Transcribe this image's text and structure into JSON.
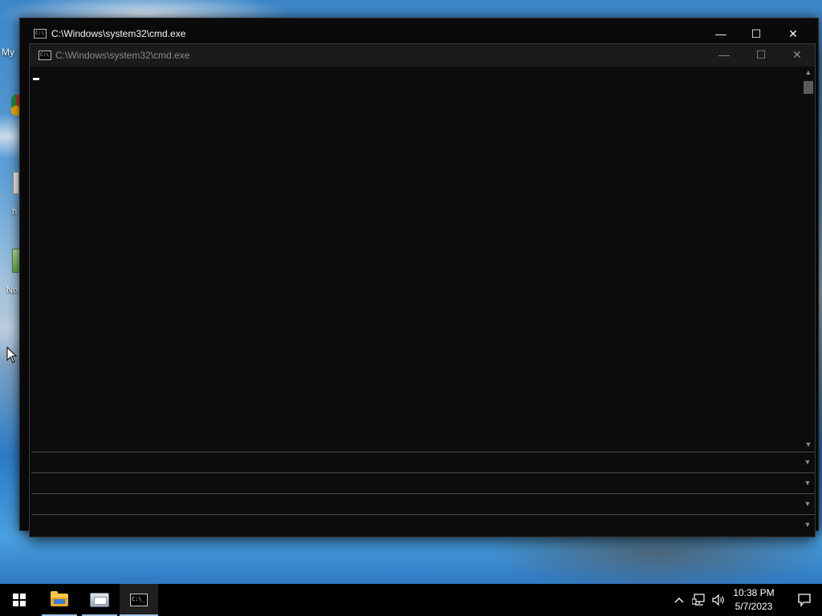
{
  "desktop": {
    "icon_fragments": [
      "My",
      "h",
      "No"
    ]
  },
  "back_window": {
    "title": "C:\\Windows\\system32\\cmd.exe",
    "icon_text": "C:\\",
    "buttons": {
      "minimize": "—",
      "maximize": "☐",
      "close": "✕"
    }
  },
  "front_window": {
    "title": "C:\\Windows\\system32\\cmd.exe",
    "icon_text": "C:\\",
    "buttons": {
      "minimize": "—",
      "maximize": "☐",
      "close": "✕"
    },
    "console_text": "",
    "panes": [
      {
        "text": ""
      },
      {
        "text": ""
      },
      {
        "text": ""
      },
      {
        "text": ""
      }
    ]
  },
  "taskbar": {
    "pinned": [
      {
        "name": "start",
        "icon": "windows-logo-icon"
      },
      {
        "name": "file-explorer",
        "icon": "folder-icon"
      },
      {
        "name": "server-manager",
        "icon": "server-manager-icon"
      },
      {
        "name": "command-prompt",
        "icon": "cmd-icon",
        "icon_text": "C:\\_"
      }
    ],
    "tray": {
      "chevron": "^",
      "network_icon": "network-icon",
      "volume_icon": "speaker-icon"
    },
    "clock": {
      "time": "10:38 PM",
      "date": "5/7/2023"
    },
    "notification_icon": "action-center-icon"
  }
}
